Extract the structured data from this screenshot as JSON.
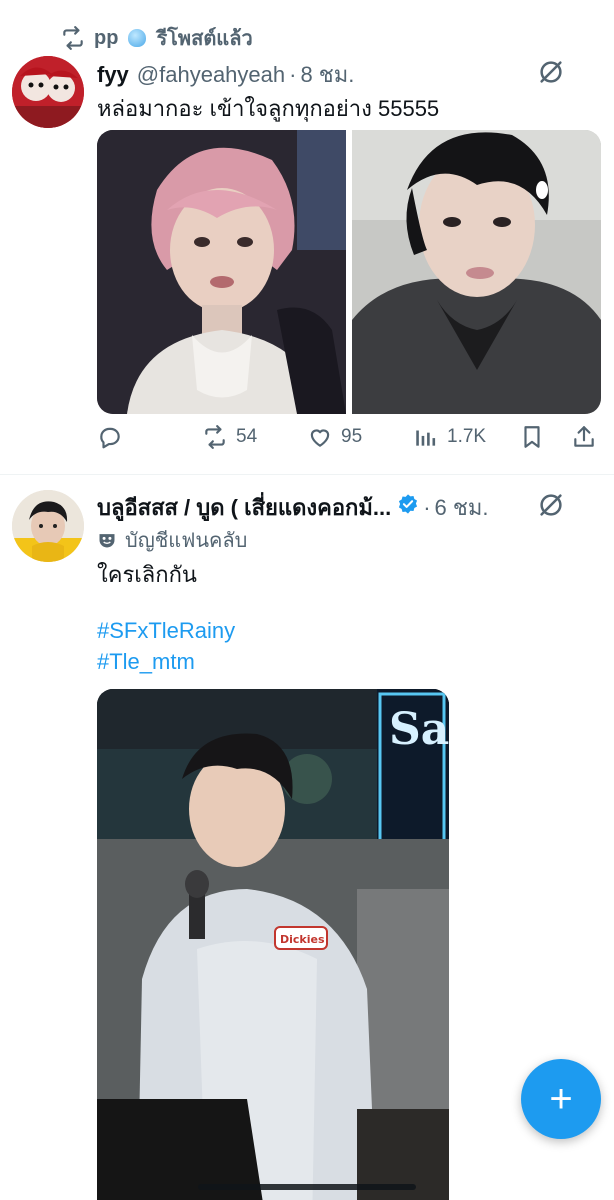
{
  "repost": {
    "user": "pp",
    "label": "รีโพสต์แล้ว"
  },
  "tweet1": {
    "name": "fyy",
    "handle": "@fahyeahyeah",
    "separator": "·",
    "time": "8 ชม.",
    "text": "หล่อมากอะ เข้าใจลูกทุกอย่าง 55555",
    "stats": {
      "replies": "",
      "reposts": "54",
      "likes": "95",
      "views": "1.7K"
    }
  },
  "tweet2": {
    "name": "บลูอีสสส / บูด ( เสี่ยแดงคอกม้...",
    "separator": "·",
    "time": "6 ชม.",
    "fanclub_label": "บัญชีแฟนคลับ",
    "text": "ใครเลิกกัน",
    "hashtags": [
      "#SFxTleRainy",
      "#Tle_mtm"
    ]
  },
  "colors": {
    "accent": "#1d9bf0",
    "muted": "#536471",
    "text": "#0f1419"
  },
  "icons": [
    "repost-icon",
    "grok-icon",
    "reply-icon",
    "like-icon",
    "views-icon",
    "bookmark-icon",
    "share-icon",
    "verified-icon",
    "fanclub-mask-icon",
    "compose-plus-icon"
  ]
}
